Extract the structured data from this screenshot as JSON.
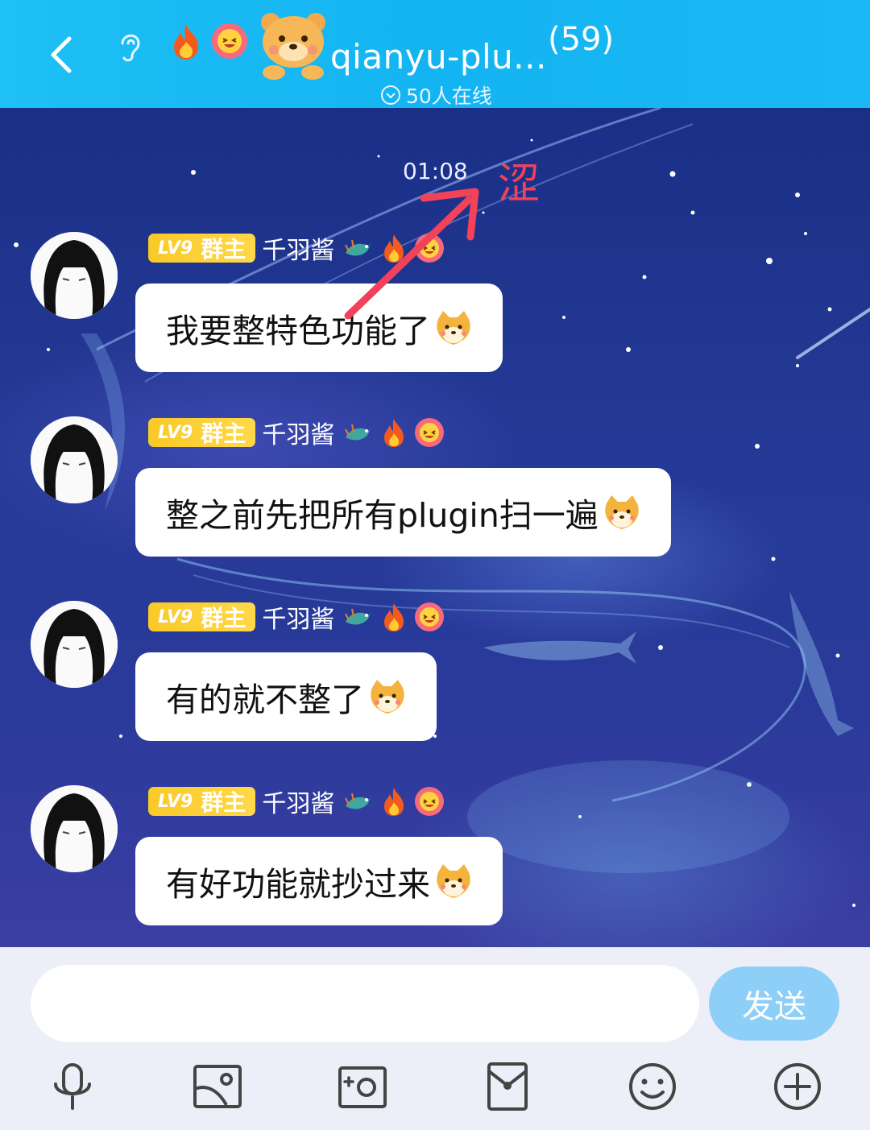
{
  "header": {
    "title": "qianyu-plu...",
    "member_count": "(59)",
    "online_text": "50人在线"
  },
  "chat": {
    "timestamp": "01:08",
    "annotation": "涩",
    "messages": [
      {
        "level": "LV9",
        "role": "群主",
        "sender": "千羽酱",
        "text": "我要整特色功能了"
      },
      {
        "level": "LV9",
        "role": "群主",
        "sender": "千羽酱",
        "text": "整之前先把所有plugin扫一遍"
      },
      {
        "level": "LV9",
        "role": "群主",
        "sender": "千羽酱",
        "text": "有的就不整了"
      },
      {
        "level": "LV9",
        "role": "群主",
        "sender": "千羽酱",
        "text": "有好功能就抄过来"
      }
    ]
  },
  "composer": {
    "input_value": "",
    "send_label": "发送"
  },
  "toolbar": [
    "microphone-icon",
    "image-icon",
    "camera-icon",
    "red-packet-icon",
    "emoji-icon",
    "plus-icon"
  ],
  "colors": {
    "header": "#14b4f2",
    "badge": "#f9c928",
    "send_button": "#8dcff6",
    "annotation": "#f2425a"
  }
}
